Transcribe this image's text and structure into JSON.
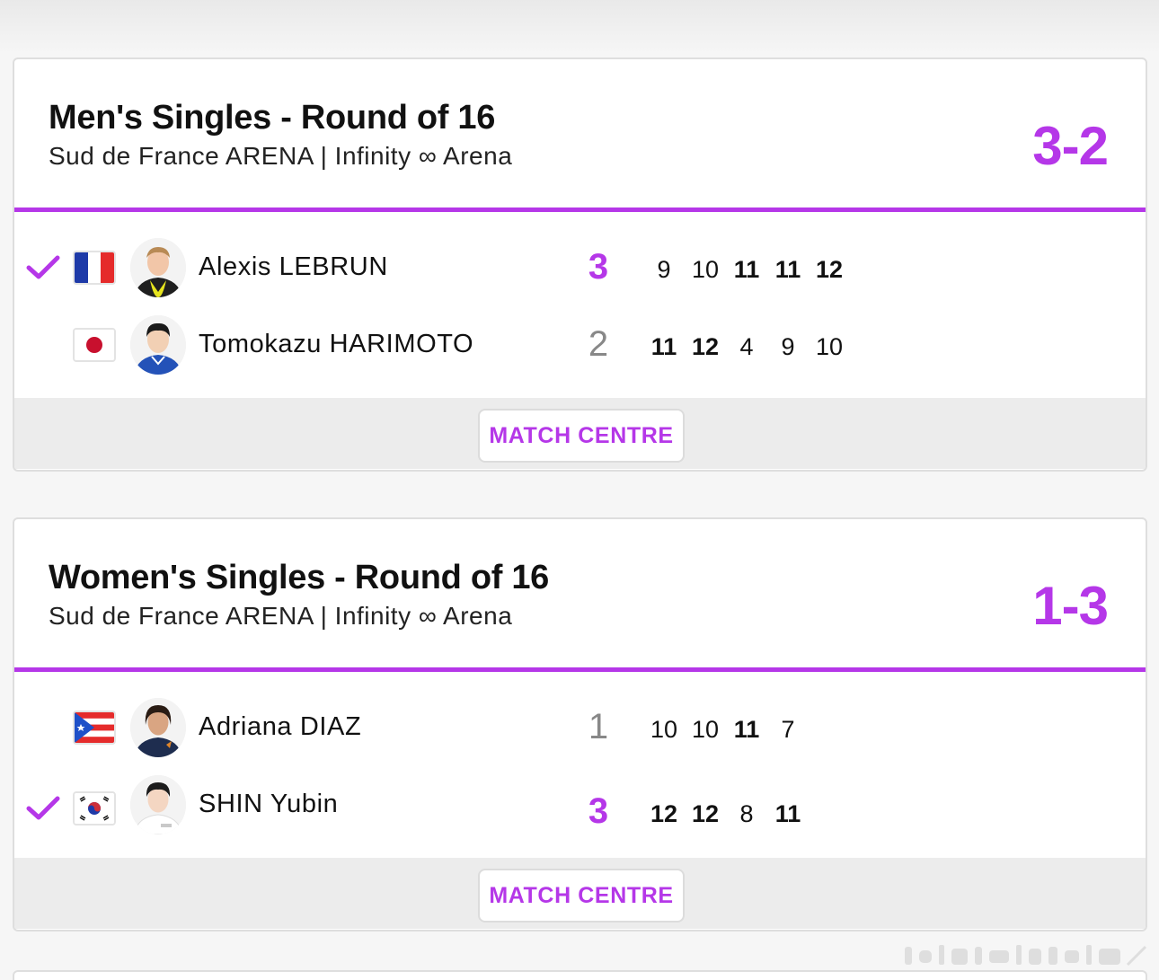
{
  "matches": [
    {
      "title": "Men's Singles - Round of 16",
      "venue": "Sud de France ARENA | Infinity ∞ Arena",
      "score": "3-2",
      "button_label": "MATCH CENTRE",
      "players": [
        {
          "name": "Alexis LEBRUN",
          "flag": "france-flag",
          "sets": "3",
          "winner": true,
          "games": [
            "9",
            "10",
            "11",
            "11",
            "12"
          ]
        },
        {
          "name": "Tomokazu HARIMOTO",
          "flag": "japan-flag",
          "sets": "2",
          "winner": false,
          "games": [
            "11",
            "12",
            "4",
            "9",
            "10"
          ]
        }
      ]
    },
    {
      "title": "Women's Singles - Round of 16",
      "venue": "Sud de France ARENA | Infinity ∞ Arena",
      "score": "1-3",
      "button_label": "MATCH CENTRE",
      "players": [
        {
          "name": "Adriana DIAZ",
          "flag": "puerto-rico-flag",
          "sets": "1",
          "winner": false,
          "games": [
            "10",
            "10",
            "11",
            "7"
          ]
        },
        {
          "name": "SHIN Yubin",
          "flag": "korea-flag",
          "sets": "3",
          "winner": true,
          "games": [
            "12",
            "12",
            "8",
            "11"
          ]
        }
      ]
    }
  ],
  "colors": {
    "accent": "#b537e8",
    "text": "#111111",
    "muted": "#888888"
  }
}
